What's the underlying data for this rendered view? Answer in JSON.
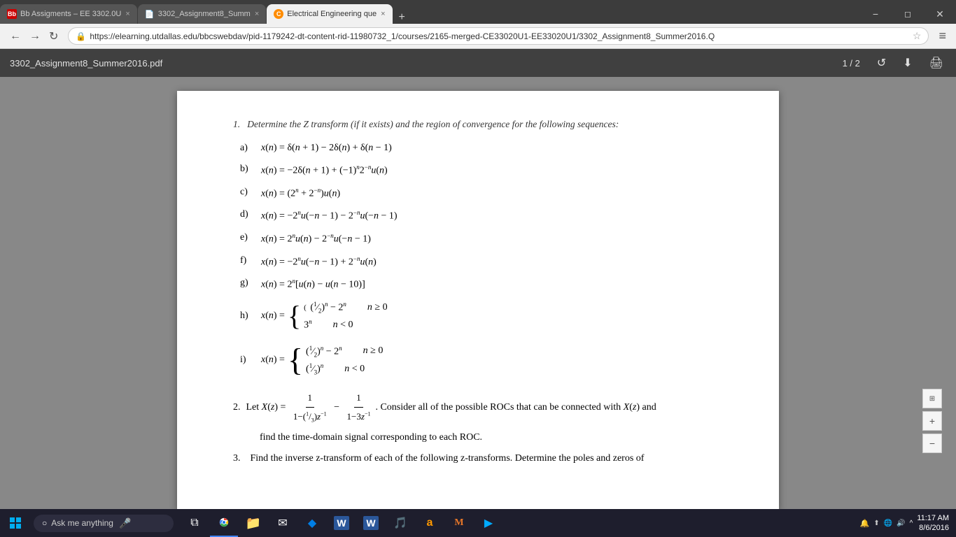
{
  "browser": {
    "tabs": [
      {
        "id": "tab1",
        "label": "Bb Assigments – EE 3302.0U",
        "favicon": "Bb",
        "favicon_color": "#cc0000",
        "active": false
      },
      {
        "id": "tab2",
        "label": "3302_Assignment8_Summ",
        "favicon": "📄",
        "active": false
      },
      {
        "id": "tab3",
        "label": "Electrical Engineering que",
        "favicon": "C",
        "favicon_color": "#ff8c00",
        "active": true
      }
    ],
    "url": "https://elearning.utdallas.edu/bbcswebdav/pid-1179242-dt-content-rid-11980732_1/courses/2165-merged-CE33020U1-EE33020U1/3302_Assignment8_Summer2016.Q",
    "nav": {
      "back": "←",
      "forward": "→",
      "refresh": "↻",
      "home": "⌂"
    }
  },
  "pdf": {
    "filename": "3302_Assignment8_Summer2016.pdf",
    "page_info": "1 / 2",
    "actions": {
      "rotate": "↺",
      "download": "⬇",
      "print": "🖨"
    }
  },
  "content": {
    "cut_off_text": "Determine the Z transform (if it exists) and the region of convergence for the following sequences:",
    "problems": [
      {
        "label": "a)",
        "eq": "x(n) = δ(n + 1) − 2δ(n) + δ(n − 1)"
      },
      {
        "label": "b)",
        "eq": "x(n) = −2δ(n + 1) + (−1)ⁿ2⁻ⁿu(n)"
      },
      {
        "label": "c)",
        "eq": "x(n) = (2ⁿ + 2⁻ⁿ)u(n)"
      },
      {
        "label": "d)",
        "eq": "x(n) = −2ⁿu(−n − 1) − 2⁻ⁿu(−n − 1)"
      },
      {
        "label": "e)",
        "eq": "x(n) = 2ⁿu(n) − 2⁻ⁿu(−n − 1)"
      },
      {
        "label": "f)",
        "eq": "x(n) = −2ⁿu(−n − 1) + 2⁻ⁿu(n)"
      },
      {
        "label": "g)",
        "eq": "x(n) = 2ⁿ[u(n) − u(n − 10)]"
      }
    ],
    "problem_h": {
      "label": "h)",
      "eq_label": "x(n) =",
      "brace_lines": [
        {
          "expr": "(1/2)ⁿ − 2ⁿ",
          "cond": "n ≥ 0"
        },
        {
          "expr": "3ⁿ",
          "cond": "n < 0"
        }
      ]
    },
    "problem_i": {
      "label": "i)",
      "eq_label": "x(n) =",
      "brace_lines": [
        {
          "expr": "(1/2)ⁿ − 2ⁿ",
          "cond": "n ≥ 0"
        },
        {
          "expr": "(1/3)ⁿ",
          "cond": "n < 0"
        }
      ]
    },
    "problem_2": {
      "number": "2.",
      "text_before": "Let X(z) =",
      "fraction1_num": "1",
      "fraction1_den": "1−(1/3)z⁻¹",
      "minus": "−",
      "fraction2_num": "1",
      "fraction2_den": "1−3z⁻¹",
      "text_after": ". Consider all of the possible ROCs that can be connected with X(z) and"
    },
    "problem_2_cont": "find the time-domain signal corresponding to each ROC.",
    "problem_3": {
      "number": "3.",
      "text": "Find the inverse z-transform of each of the following z-transforms. Determine the poles and zeros of"
    }
  },
  "taskbar": {
    "search_placeholder": "Ask me anything",
    "time": "11:17 AM",
    "date": "8/6/2016",
    "apps": [
      {
        "name": "windows",
        "icon": "⊞",
        "color": "#0078d7"
      },
      {
        "name": "cortana",
        "icon": "○",
        "color": "#fff"
      },
      {
        "name": "chrome",
        "icon": "●",
        "color": "#4285f4"
      },
      {
        "name": "explorer",
        "icon": "📁",
        "color": "#f0a500"
      },
      {
        "name": "mail",
        "icon": "✉",
        "color": "#0078d7"
      },
      {
        "name": "dropbox",
        "icon": "◆",
        "color": "#007ee5"
      },
      {
        "name": "word",
        "icon": "W",
        "color": "#2b579a"
      },
      {
        "name": "winword2",
        "icon": "W",
        "color": "#2b579a"
      },
      {
        "name": "music",
        "icon": "♪",
        "color": "#e74c3c"
      },
      {
        "name": "amazon",
        "icon": "a",
        "color": "#ff9900"
      },
      {
        "name": "matlab",
        "icon": "M",
        "color": "#e77729"
      },
      {
        "name": "media",
        "icon": "▶",
        "color": "#00a"
      }
    ]
  }
}
